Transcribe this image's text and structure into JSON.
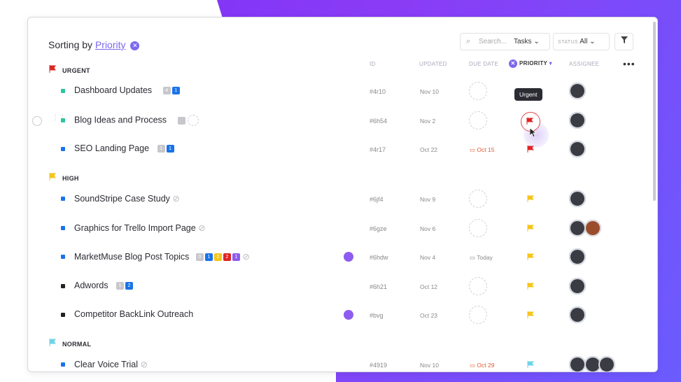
{
  "header": {
    "sorting_prefix": "Sorting by",
    "sorting_field": "Priority",
    "clear_icon": "close-icon",
    "search_placeholder": "Search...",
    "search_scope": "Tasks",
    "status_label": "STATUS",
    "status_value": "All",
    "filter_icon": "filter-icon"
  },
  "columns": {
    "id": "ID",
    "updated": "UPDATED",
    "due_date": "DUE DATE",
    "priority": "PRIORITY",
    "assignee": "ASSIGNEE"
  },
  "groups": {
    "urgent": {
      "label": "URGENT",
      "color": "#e02424"
    },
    "high": {
      "label": "HIGH",
      "color": "#f5c518"
    },
    "normal": {
      "label": "NORMAL",
      "color": "#6fd3e8"
    }
  },
  "tooltip": "Urgent",
  "tasks": [
    {
      "name": "Dashboard Updates",
      "id": "#4r10",
      "updated": "Nov 10",
      "due": "",
      "color": "#2ec4a0"
    },
    {
      "name": "Blog Ideas and Process",
      "id": "#6h54",
      "updated": "Nov 2",
      "due": "",
      "color": "#2ec4a0"
    },
    {
      "name": "SEO Landing Page",
      "id": "#4r17",
      "updated": "Oct 22",
      "due": "Oct 15",
      "color": "#1a73e8"
    },
    {
      "name": "SoundStripe Case Study",
      "id": "#6jf4",
      "updated": "Nov 9",
      "due": "",
      "color": "#1a73e8"
    },
    {
      "name": "Graphics for Trello Import Page",
      "id": "#6gze",
      "updated": "Nov 6",
      "due": "",
      "color": "#1a73e8"
    },
    {
      "name": "MarketMuse Blog Post Topics",
      "id": "#6hdw",
      "updated": "Nov 4",
      "due": "Today",
      "color": "#1a73e8"
    },
    {
      "name": "Adwords",
      "id": "#6h21",
      "updated": "Oct 12",
      "due": "",
      "color": "#222"
    },
    {
      "name": "Competitor BackLink Outreach",
      "id": "#bvg",
      "updated": "Oct 23",
      "due": "",
      "color": "#222"
    },
    {
      "name": "Clear Voice Trial",
      "id": "#4919",
      "updated": "Nov 10",
      "due": "Oct 29",
      "color": "#1a73e8"
    }
  ],
  "badges": {
    "dashboard": [
      "4",
      "1"
    ],
    "seo": [
      "1",
      "1"
    ],
    "marketmuse": [
      "0",
      "1",
      "2",
      "2",
      "1"
    ],
    "adwords": [
      "1",
      "2"
    ]
  }
}
